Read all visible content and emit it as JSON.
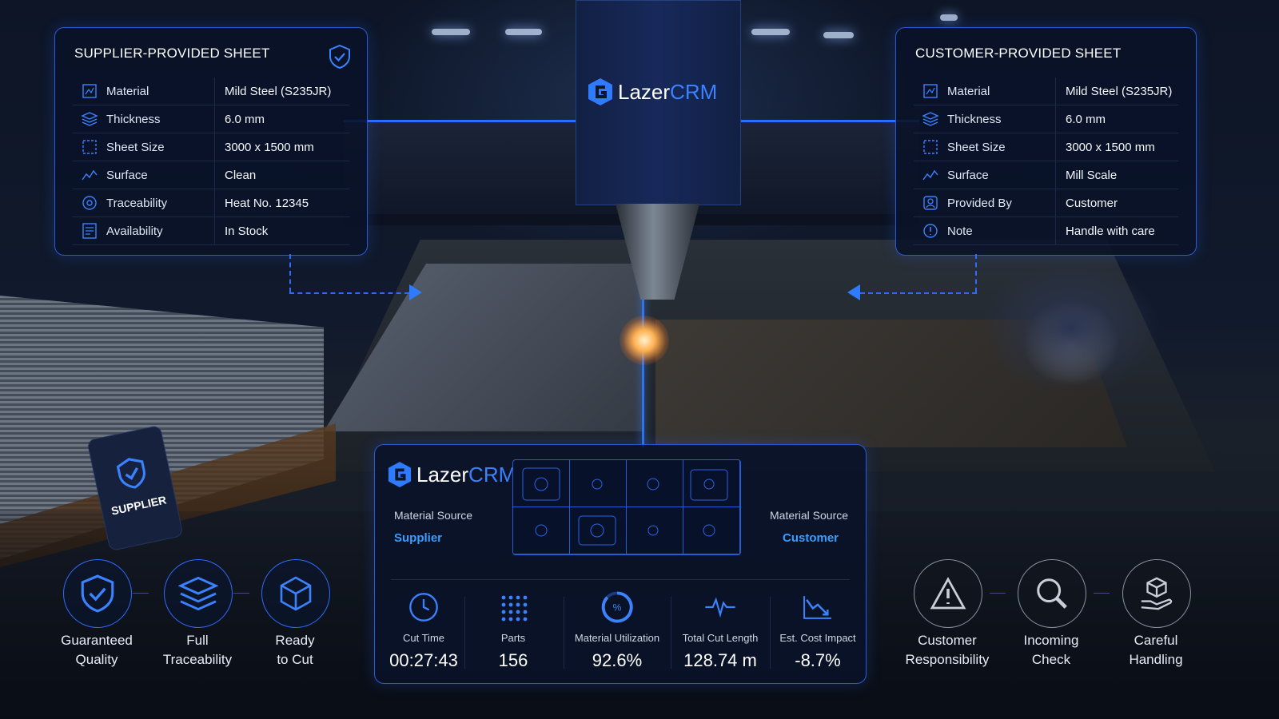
{
  "brand": {
    "name_a": "Lazer",
    "name_b": "CRM"
  },
  "supplier_panel": {
    "title": "SUPPLIER-PROVIDED SHEET",
    "rows": [
      {
        "icon": "material-icon",
        "label": "Material",
        "value": "Mild Steel (S235JR)"
      },
      {
        "icon": "layers-icon",
        "label": "Thickness",
        "value": "6.0 mm"
      },
      {
        "icon": "sheet-size-icon",
        "label": "Sheet Size",
        "value": "3000 x 1500 mm"
      },
      {
        "icon": "surface-icon",
        "label": "Surface",
        "value": "Clean"
      },
      {
        "icon": "traceability-icon",
        "label": "Traceability",
        "value": "Heat No. 12345"
      },
      {
        "icon": "availability-icon",
        "label": "Availability",
        "value": "In Stock"
      }
    ]
  },
  "customer_panel": {
    "title": "CUSTOMER-PROVIDED SHEET",
    "rows": [
      {
        "icon": "material-icon",
        "label": "Material",
        "value": "Mild Steel (S235JR)"
      },
      {
        "icon": "layers-icon",
        "label": "Thickness",
        "value": "6.0 mm"
      },
      {
        "icon": "sheet-size-icon",
        "label": "Sheet Size",
        "value": "3000 x 1500 mm"
      },
      {
        "icon": "surface-icon",
        "label": "Surface",
        "value": "Mill Scale"
      },
      {
        "icon": "user-icon",
        "label": "Provided By",
        "value": "Customer"
      },
      {
        "icon": "note-icon",
        "label": "Note",
        "value": "Handle with care"
      }
    ]
  },
  "supplier_tag": {
    "label": "SUPPLIER"
  },
  "left_features": [
    {
      "icon": "shield-check-icon",
      "line1": "Guaranteed",
      "line2": "Quality"
    },
    {
      "icon": "layers-icon",
      "line1": "Full",
      "line2": "Traceability"
    },
    {
      "icon": "box-icon",
      "line1": "Ready",
      "line2": "to Cut"
    }
  ],
  "right_features": [
    {
      "icon": "warning-icon",
      "line1": "Customer",
      "line2": "Responsibility"
    },
    {
      "icon": "magnifier-icon",
      "line1": "Incoming",
      "line2": "Check"
    },
    {
      "icon": "hand-box-icon",
      "line1": "Careful",
      "line2": "Handling"
    }
  ],
  "stats_panel": {
    "source_left": {
      "label": "Material Source",
      "value": "Supplier"
    },
    "source_right": {
      "label": "Material Source",
      "value": "Customer"
    },
    "stats": [
      {
        "icon": "clock-icon",
        "label": "Cut Time",
        "value": "00:27:43"
      },
      {
        "icon": "grid-dots-icon",
        "label": "Parts",
        "value": "156"
      },
      {
        "icon": "utilization-gauge-icon",
        "label": "Material Utilization",
        "value": "92.6%"
      },
      {
        "icon": "pulse-icon",
        "label": "Total Cut Length",
        "value": "128.74 m"
      },
      {
        "icon": "trend-down-icon",
        "label": "Est. Cost Impact",
        "value": "-8.7%"
      }
    ]
  },
  "colors": {
    "accent": "#2f6bff",
    "highlight": "#3b9dff",
    "panel_bg": "#091228",
    "muted_ring": "#8a93a3"
  }
}
